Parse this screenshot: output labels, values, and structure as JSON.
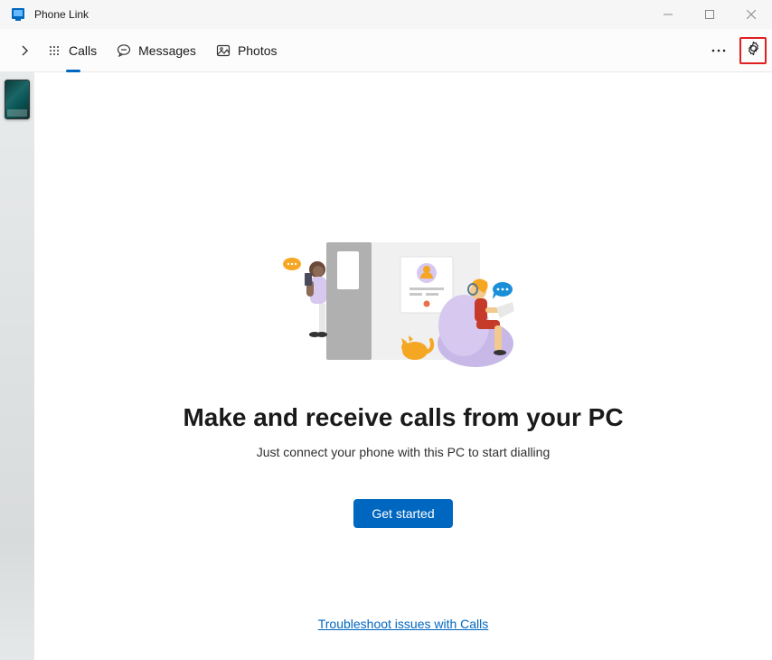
{
  "app": {
    "title": "Phone Link"
  },
  "tabs": {
    "calls": "Calls",
    "messages": "Messages",
    "photos": "Photos"
  },
  "hero": {
    "title": "Make and receive calls from your PC",
    "subtitle": "Just connect your phone with this PC to start dialling",
    "button": "Get started"
  },
  "footer": {
    "troubleshoot": "Troubleshoot issues with Calls"
  },
  "colors": {
    "accent": "#0067c0",
    "highlight_border": "#e02020"
  }
}
